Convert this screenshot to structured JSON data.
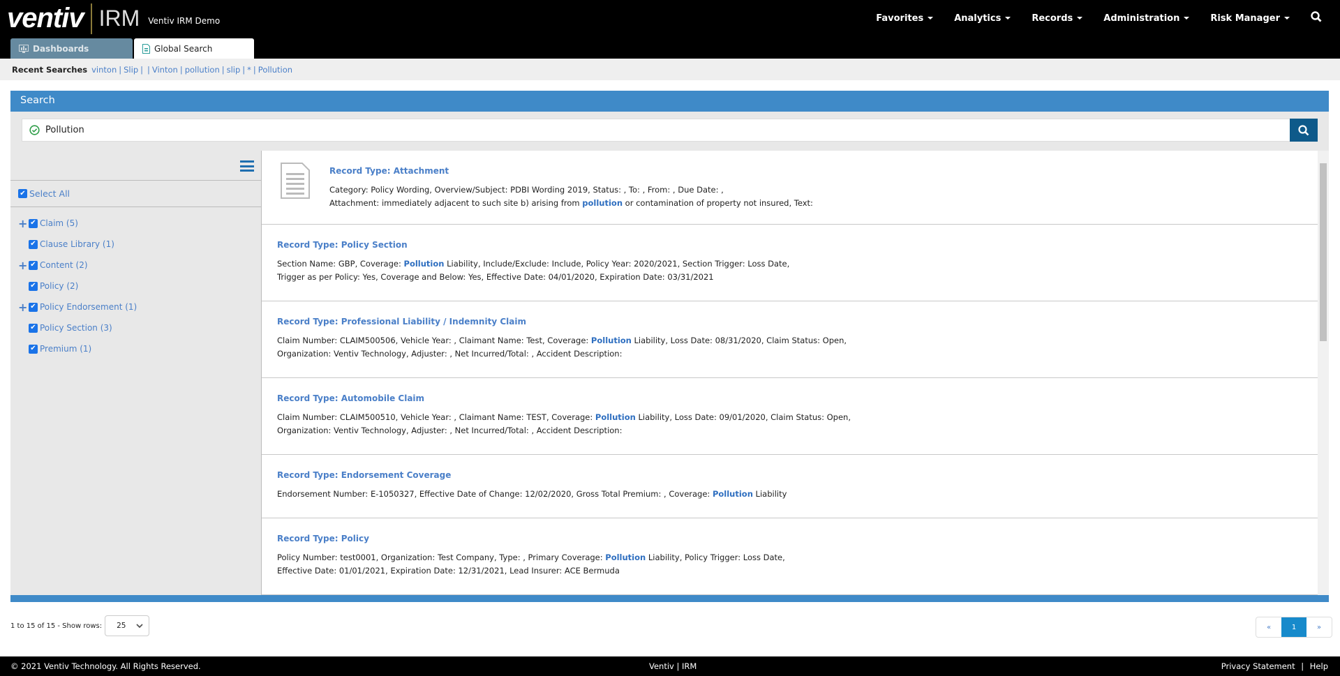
{
  "header": {
    "logo_text": "ventiv",
    "logo_product": "IRM",
    "app_title": "Ventiv IRM Demo",
    "nav": [
      "Favorites",
      "Analytics",
      "Records",
      "Administration",
      "Risk Manager"
    ]
  },
  "tabs": [
    {
      "label": "Dashboards",
      "icon": "dashboard-icon"
    },
    {
      "label": "Global Search",
      "icon": "document-icon"
    }
  ],
  "recent": {
    "label": "Recent Searches",
    "items": [
      "vinton",
      "Slip",
      "",
      "Vinton",
      "pollution",
      "slip",
      "*",
      "Pollution"
    ]
  },
  "search": {
    "panel_title": "Search",
    "value": "Pollution"
  },
  "filters": {
    "select_all": "Select All",
    "items": [
      {
        "label": "Claim (5)",
        "expandable": true
      },
      {
        "label": "Clause Library (1)",
        "expandable": false
      },
      {
        "label": "Content (2)",
        "expandable": true
      },
      {
        "label": "Policy (2)",
        "expandable": false
      },
      {
        "label": "Policy Endorsement (1)",
        "expandable": true
      },
      {
        "label": "Policy Section (3)",
        "expandable": false
      },
      {
        "label": "Premium (1)",
        "expandable": false
      }
    ]
  },
  "results": [
    {
      "title": "Record Type: Attachment",
      "lines": [
        [
          "Category: Policy Wording,  Overview/Subject: PDBI Wording 2019,  Status: ,  To: ,  From: ,  Due Date: ,"
        ],
        [
          "Attachment: immediately adjacent to such site b) arising from ",
          "pollution",
          " or contamination of property not insured,  Text:"
        ]
      ]
    },
    {
      "title": "Record Type: Policy Section",
      "lines": [
        [
          "Section Name: GBP,  Coverage: ",
          "Pollution",
          " Liability,  Include/Exclude: Include,  Policy Year: 2020/2021,  Section Trigger: Loss Date,"
        ],
        [
          "Trigger as per Policy: Yes,  Coverage and Below: Yes,  Effective Date: 04/01/2020,  Expiration Date: 03/31/2021"
        ]
      ]
    },
    {
      "title": "Record Type: Professional Liability / Indemnity Claim",
      "lines": [
        [
          "Claim Number: CLAIM500506,  Vehicle Year: ,  Claimant Name: Test,  Coverage: ",
          "Pollution",
          " Liability,  Loss Date: 08/31/2020,  Claim Status: Open,"
        ],
        [
          "Organization: Ventiv Technology,  Adjuster: ,  Net Incurred/Total: ,  Accident Description:"
        ]
      ]
    },
    {
      "title": "Record Type: Automobile Claim",
      "lines": [
        [
          "Claim Number: CLAIM500510,  Vehicle Year: ,  Claimant Name: TEST,  Coverage: ",
          "Pollution",
          " Liability,  Loss Date: 09/01/2020,  Claim Status: Open,"
        ],
        [
          "Organization: Ventiv Technology,  Adjuster: ,  Net Incurred/Total: ,  Accident Description:"
        ]
      ]
    },
    {
      "title": "Record Type: Endorsement Coverage",
      "lines": [
        [
          "Endorsement Number: E-1050327,  Effective Date of Change: 12/02/2020,  Gross Total Premium: ,  Coverage: ",
          "Pollution",
          " Liability"
        ]
      ]
    },
    {
      "title": "Record Type: Policy",
      "lines": [
        [
          "Policy Number: test0001,  Organization: Test Company,  Type: ,  Primary Coverage: ",
          "Pollution",
          " Liability,  Policy Trigger: Loss Date,"
        ],
        [
          "Effective Date: 01/01/2021,  Expiration Date: 12/31/2021,  Lead Insurer: ACE Bermuda"
        ]
      ]
    }
  ],
  "pagination": {
    "info": "1 to 15 of 15 - Show rows:",
    "rows": "25",
    "prev": "«",
    "current": "1",
    "next": "»"
  },
  "footer": {
    "copyright": "© 2021 Ventiv Technology. All Rights Reserved.",
    "center": "Ventiv | IRM",
    "privacy": "Privacy Statement",
    "sep": "|",
    "help": "Help"
  },
  "colors": {
    "header": "#000000",
    "accent": "#3f8ac8",
    "link": "#4a7fc8",
    "search_button": "#0e5a8a"
  }
}
